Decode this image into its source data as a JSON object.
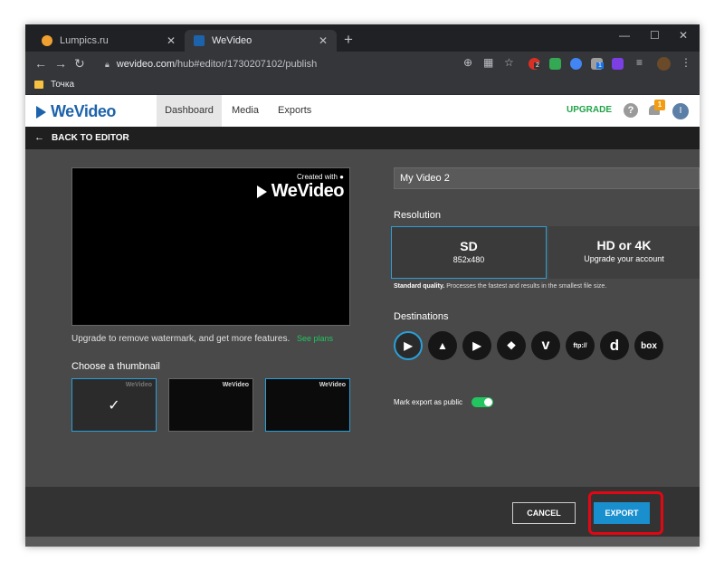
{
  "browser": {
    "tabs": [
      {
        "title": "Lumpics.ru",
        "favicon_color": "#f0a030",
        "active": false
      },
      {
        "title": "WeVideo",
        "favicon_color": "#1d63ab",
        "active": true
      }
    ],
    "new_tab_glyph": "+",
    "window_controls": [
      "—",
      "☐",
      "✕"
    ],
    "url_domain": "wevideo.com",
    "url_path": "/hub#editor/1730207102/publish",
    "extension_badges": [
      "2",
      "1"
    ],
    "bookmark": "Точка"
  },
  "app": {
    "logo_text": "WeVideo",
    "nav": [
      "Dashboard",
      "Media",
      "Exports"
    ],
    "upgrade_label": "UPGRADE",
    "help_glyph": "?",
    "notification_count": "1",
    "user_initial": "I",
    "back_label": "BACK TO EDITOR"
  },
  "preview": {
    "watermark_small": "Created with ●",
    "watermark_big": "WeVideo",
    "upgrade_text": "Upgrade to remove watermark, and get more features.",
    "see_plans": "See plans"
  },
  "thumbnails": {
    "heading": "Choose a thumbnail",
    "items": [
      {
        "watermark": "WeVideo",
        "selected": true
      },
      {
        "watermark": "WeVideo",
        "selected": false
      },
      {
        "watermark": "WeVideo",
        "selected": false
      }
    ]
  },
  "publish": {
    "title_value": "My Video 2",
    "resolution_heading": "Resolution",
    "options": [
      {
        "label": "SD",
        "sub": "852x480",
        "selected": true
      },
      {
        "label": "HD or 4K",
        "sub": "Upgrade your account",
        "selected": false
      }
    ],
    "desc_bold": "Standard quality.",
    "desc_rest": "Processes the fastest and results in the smallest file size.",
    "destinations_heading": "Destinations",
    "destinations": [
      {
        "name": "WeVideo",
        "glyph": "▶"
      },
      {
        "name": "Google Drive",
        "glyph": "▲"
      },
      {
        "name": "YouTube",
        "glyph": "▶"
      },
      {
        "name": "Dropbox",
        "glyph": "❖"
      },
      {
        "name": "Vimeo",
        "glyph": "v"
      },
      {
        "name": "FTP",
        "glyph": "ftp://"
      },
      {
        "name": "Dailymotion",
        "glyph": "d"
      },
      {
        "name": "Box",
        "glyph": "box"
      }
    ],
    "public_label": "Mark export as public",
    "public_enabled": true
  },
  "footer": {
    "cancel_label": "CANCEL",
    "export_label": "EXPORT"
  },
  "colors": {
    "accent": "#2a9fd8",
    "export": "#1a8fce",
    "green": "#22c55e",
    "highlight": "#e30613"
  }
}
